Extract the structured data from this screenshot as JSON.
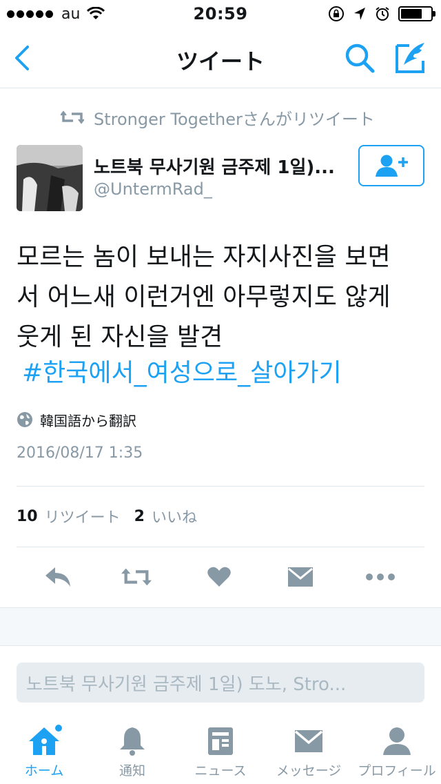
{
  "status_bar": {
    "carrier": "au",
    "time": "20:59"
  },
  "nav": {
    "title": "ツイート"
  },
  "retweet_context": {
    "text": "Stronger Togetherさんがリツイート"
  },
  "author": {
    "name": "노트북 무사기원 금주제 1일)...",
    "handle": "@UntermRad_"
  },
  "tweet": {
    "line1": "모르는 놈이 보내는 자지사진을 보면",
    "line2": "서 어느새 이런거엔 아무렇지도 않게",
    "line3": "웃게 된 자신을 발견",
    "hashtag": "#한국에서_여성으로_살아가기",
    "translate_label": "韓国語から翻訳",
    "date": "2016/08/17 1:35"
  },
  "stats": {
    "retweets": "10",
    "retweets_label": "リツイート",
    "likes": "2",
    "likes_label": "いいね"
  },
  "reply": {
    "placeholder": "노트북 무사기원 금주제 1일) 도노, Stro..."
  },
  "tabs": [
    {
      "label": "ホーム"
    },
    {
      "label": "通知"
    },
    {
      "label": "ニュース"
    },
    {
      "label": "メッセージ"
    },
    {
      "label": "プロフィール"
    }
  ],
  "colors": {
    "accent": "#1da1f2",
    "icon_gray": "#8899a6",
    "divider": "#e1e8ed"
  }
}
